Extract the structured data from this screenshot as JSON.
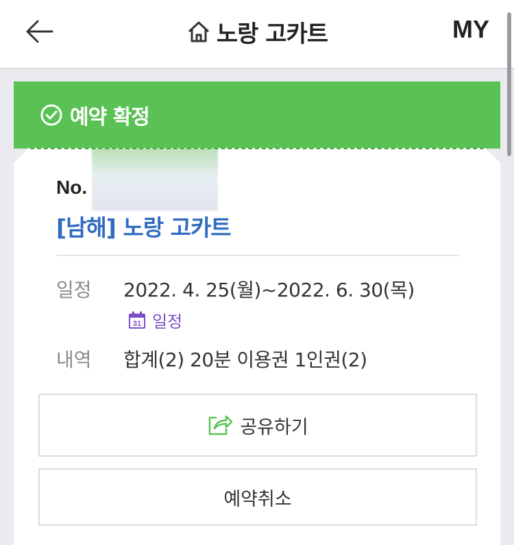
{
  "header": {
    "title": "노랑 고카트",
    "my_label": "MY",
    "back_icon": "arrow-left-icon",
    "home_icon": "home-icon"
  },
  "banner": {
    "status": "예약 확정",
    "icon": "check-circle-icon",
    "color": "#5ac254"
  },
  "reservation": {
    "no_label": "No.",
    "product_name": "[남해] 노랑 고카트",
    "schedule_label": "일정",
    "schedule_value": "2022. 4. 25(월)~2022. 6. 30(목)",
    "calendar_link": "일정",
    "calendar_icon_day": "31",
    "details_label": "내역",
    "details_value": "합계(2) 20분 이용권 1인권(2)"
  },
  "actions": {
    "share_label": "공유하기",
    "share_icon": "share-icon",
    "cancel_label": "예약취소"
  },
  "colors": {
    "accent_green": "#5ac254",
    "link_blue": "#2f6bbf",
    "calendar_purple": "#7a4fc7"
  }
}
